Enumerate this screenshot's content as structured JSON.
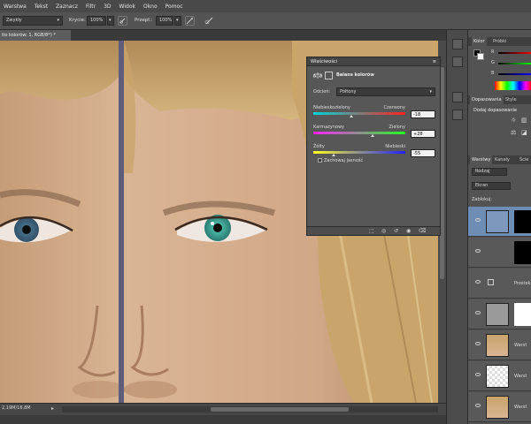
{
  "menu": [
    "Warstwa",
    "Tekst",
    "Zaznacz",
    "Filtr",
    "3D",
    "Widok",
    "Okno",
    "Pomoc"
  ],
  "options_bar": {
    "mode_value": "Zwykły",
    "opacity_label": "Krycie:",
    "opacity_value": "100%",
    "flow_label": "Przepł.:",
    "flow_value": "100%"
  },
  "document": {
    "tab_title": "ito kolorów: 1, RGB/8*) *",
    "status": "2,19M/16,8M"
  },
  "properties": {
    "panel_title": "Właściwości",
    "adjustment_title": "Balans kolorów",
    "tone_label": "Odcień:",
    "tone_value": "Półtony",
    "sliders": [
      {
        "left": "Niebieskozielony",
        "right": "Czerwony",
        "value": "-18",
        "level": 0.41,
        "gradient": [
          "#00d6d6",
          "#ff2020"
        ]
      },
      {
        "left": "Karmazynowy",
        "right": "Zielony",
        "value": "+28",
        "level": 0.64,
        "gradient": [
          "#ff20ff",
          "#20ff20"
        ]
      },
      {
        "left": "Żółty",
        "right": "Niebieski",
        "value": "-55",
        "level": 0.22,
        "gradient": [
          "#ffff20",
          "#2020ff"
        ]
      }
    ],
    "preserve_label": "Zachowaj jasność"
  },
  "right_panel": {
    "color_tabs": [
      "Kolor",
      "Próbki"
    ],
    "color_channels": [
      "R",
      "G",
      "B"
    ],
    "adjust_tabs": [
      "Dopasowania",
      "Style"
    ],
    "adjust_title": "Dodaj dopasowanie",
    "layers_tabs": [
      "Warstwy",
      "Kanały",
      "Ście"
    ],
    "filter_value": "Rodzaj",
    "blend_value": "Ekran",
    "lock_label": "Zablokuj:",
    "layers": [
      {
        "name": "",
        "type": "adjustment"
      },
      {
        "name": "",
        "type": "adjustment2"
      },
      {
        "name": "Prostokąt 1",
        "type": "group"
      },
      {
        "name": "",
        "type": "mask"
      },
      {
        "name": "Warst",
        "type": "face"
      },
      {
        "name": "Warst",
        "type": "empty"
      },
      {
        "name": "Warst",
        "type": "face"
      }
    ]
  },
  "colors": {
    "accent": "#6d8db4",
    "panel_bg": "#535353",
    "canvas_divider": "#5e5d7c"
  }
}
